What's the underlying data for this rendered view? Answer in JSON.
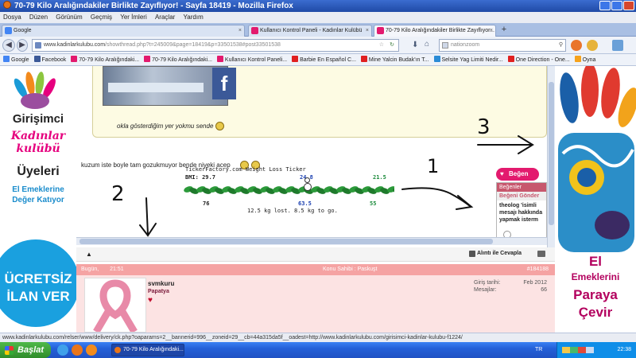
{
  "window": {
    "title": "70-79 Kilo Aralığındakiler Birlikte Zayıflıyor! - Sayfa 18419 - Mozilla Firefox"
  },
  "menu": [
    "Dosya",
    "Düzen",
    "Görünüm",
    "Geçmiş",
    "Yer İmleri",
    "Araçlar",
    "Yardım"
  ],
  "tabs": [
    {
      "label": "Google",
      "color": "#4285f4"
    },
    {
      "label": "Kullanıcı Kontrol Paneli - Kadınlar Kulübü",
      "color": "#e31a6e"
    },
    {
      "label": "70-79 Kilo Aralığındakiler Birlikte Zayıflıyor...",
      "color": "#e31a6e"
    }
  ],
  "newtab": "+",
  "nav": {
    "url_domain": "www.kadinlarkulubu.com",
    "url_path": "/showthread.php?t=245009&page=18419&p=33501538#post33501538",
    "search_placeholder": "nationzoom"
  },
  "bookmarks": [
    {
      "label": "Google",
      "color": "#4285f4"
    },
    {
      "label": "Facebook",
      "color": "#3b5998"
    },
    {
      "label": "70-79 Kilo Aralığındaki...",
      "color": "#e31a6e"
    },
    {
      "label": "70-79 Kilo Aralığındaki...",
      "color": "#e31a6e"
    },
    {
      "label": "Kullanıcı Kontrol Paneli...",
      "color": "#e31a6e"
    },
    {
      "label": "Barbie En Español C...",
      "color": "#e02020"
    },
    {
      "label": "Mine Yalcin Budak'ın T...",
      "color": "#e02020"
    },
    {
      "label": "Selsite Yag Limiti Nedir...",
      "color": "#2a8bd6"
    },
    {
      "label": "One Direction - One...",
      "color": "#e02020"
    },
    {
      "label": "Oyna",
      "color": "#f6a21a"
    }
  ],
  "left_ad": {
    "line1": "Girişimci",
    "logo1": "Kadınlar",
    "logo2": "kulübü",
    "line2": "Üyeleri",
    "line3": "El Emeklerine",
    "line4": "Değer Katıyor",
    "cta1": "ÜCRETSİZ",
    "cta2": "İLAN VER"
  },
  "right_ad": {
    "line1": "El",
    "line2": "Emeklerini",
    "line3": "Paraya",
    "line4": "Çevir"
  },
  "quote": {
    "text": "okla gösterdiğim yer yokmu sende"
  },
  "post": {
    "text": "kuzum iste boyle tam gozukmuyor bende niyeki acep"
  },
  "ticker": {
    "title": "TickerFactory.com Weight Loss Ticker",
    "bmi_label": "BMI: 29.7",
    "start": "76",
    "current_top": "24.8",
    "current": "63.5",
    "right_top": "21.5",
    "goal": "55",
    "summary": "12.5 kg lost. 8.5 kg to go.",
    "progress": 0.6
  },
  "like": {
    "button": "Beğen",
    "header": "Beğenler",
    "subheader": "Beğeni Gönder",
    "body": "theolog 'isimli mesajı hakkında yapmak isterm"
  },
  "actions": {
    "reply": "Alıntı ile Cevapla"
  },
  "next_post": {
    "date": "Bugün,",
    "time": "21:51",
    "owner": "Konu Sahibi : Paskuşt",
    "number": "#184188",
    "user": "svmkuru",
    "rank": "Papatya",
    "join_label": "Giriş tarihi:",
    "join_value": "Feb 2012",
    "msgs_label": "Mesajlar:",
    "msgs_value": "66"
  },
  "annotations": {
    "n1": "1",
    "n2": "2",
    "n3": "3"
  },
  "statusbar": "www.kadinlarkulubu.com/relser/www/delivery/ck.php?oaparams=2__bannerid=996__zoneid=29__cb=44a315da5f__oadest=http://www.kadinlarkulubu.com/girisimci-kadinlar-kulubu-f1224/",
  "taskbar": {
    "start": "Başlat",
    "task": "70-79 Kilo Aralığındaki...",
    "lang": "TR",
    "clock": "22:38"
  }
}
